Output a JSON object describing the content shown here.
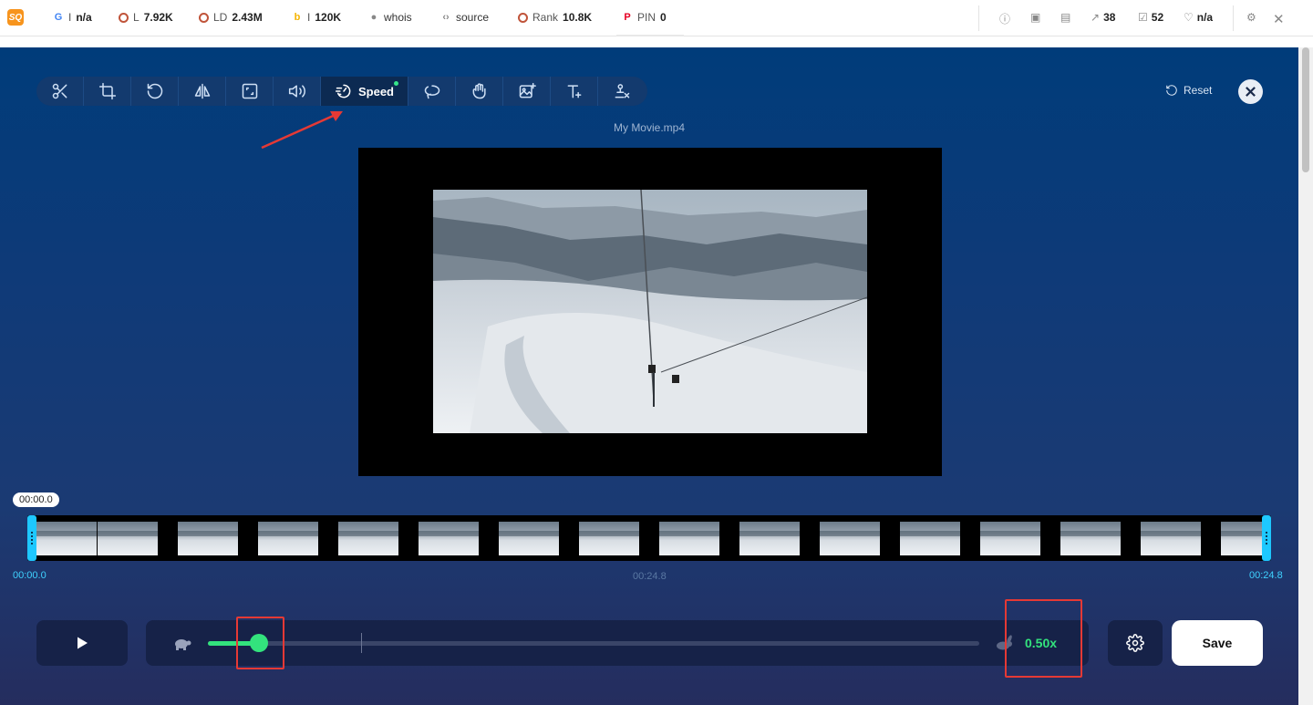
{
  "seo_bar": {
    "google": {
      "prefix": "I",
      "value": "n/a"
    },
    "links": {
      "prefix": "L",
      "value": "7.92K"
    },
    "linking_domains": {
      "prefix": "LD",
      "value": "2.43M"
    },
    "bing": {
      "prefix": "I",
      "value": "120K"
    },
    "whois": "whois",
    "source": "source",
    "rank": {
      "prefix": "Rank",
      "value": "10.8K"
    },
    "pin": {
      "prefix": "PIN",
      "value": "0"
    },
    "external_links": "38",
    "internal_links": "52",
    "diagnosis": "n/a"
  },
  "toolbar": {
    "active_label": "Speed",
    "tools": [
      "scissors-icon",
      "crop-icon",
      "rotate-icon",
      "flip-icon",
      "resize-icon",
      "volume-icon",
      "speed-icon",
      "loop-icon",
      "stabilize-icon",
      "image-icon",
      "text-icon",
      "watermark-remove-icon"
    ]
  },
  "reset_label": "Reset",
  "filename": "My Movie.mp4",
  "timeline": {
    "current": "00:00.0",
    "start": "00:00.0",
    "middle": "00:24.8",
    "end": "00:24.8"
  },
  "speed": {
    "value_label": "0.50x",
    "value": 0.5,
    "position_fraction": 0.066
  },
  "save_label": "Save",
  "colors": {
    "accent_green": "#33e37d",
    "timeline_cyan": "#1ec8ff",
    "annotation_red": "#e53935"
  }
}
